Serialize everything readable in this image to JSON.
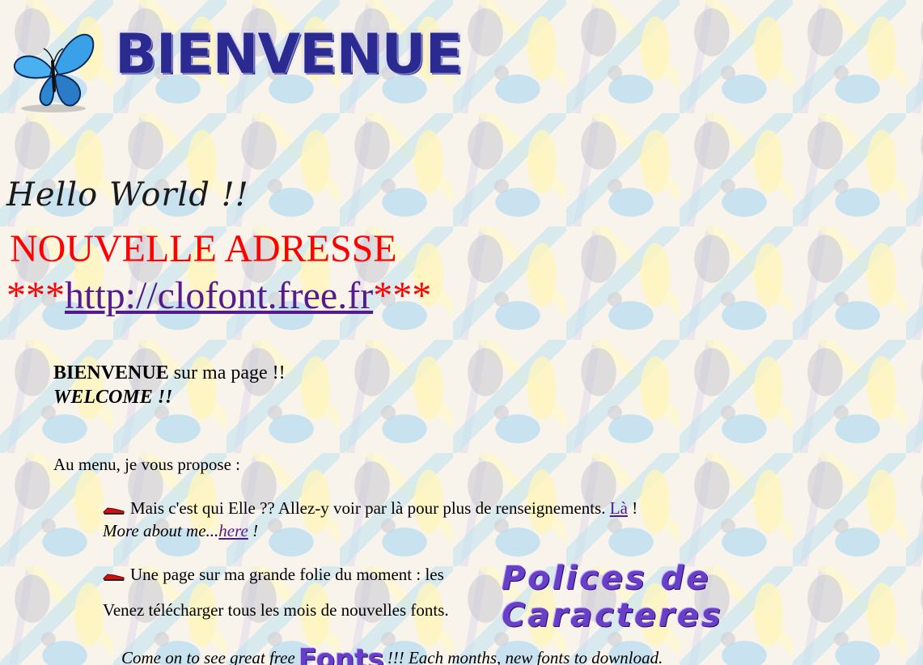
{
  "header": {
    "banner_title": "BIENVENUE",
    "hello": "Hello World !!",
    "new_address": "NOUVELLE ADRESSE",
    "url_prefix": "***",
    "url_text": "http://clofont.free.fr",
    "url_suffix": "***"
  },
  "welcome": {
    "bold": "BIENVENUE",
    "rest": " sur ma page !!",
    "english": "WELCOME !!"
  },
  "menu": {
    "intro": "Au menu, je vous propose :",
    "item1": {
      "text": "Mais c'est qui Elle ?? Allez-y voir par là pour plus de renseignements. ",
      "link": "Là",
      "after": " !",
      "en_text": "More about me...",
      "en_link": "here",
      "en_after": " !"
    },
    "item2": {
      "text": "Une page sur ma grande folie du moment : les",
      "fancy": "Polices de Caracteres",
      "sub": "Venez télécharger tous les mois de nouvelles fonts."
    },
    "item3": {
      "before": "Come on to see great free",
      "fancy": "Fonts",
      "after": "!!! Each months, new fonts to download."
    }
  },
  "colors": {
    "accent_red": "#ff0000",
    "link_visited": "#551a8b"
  }
}
